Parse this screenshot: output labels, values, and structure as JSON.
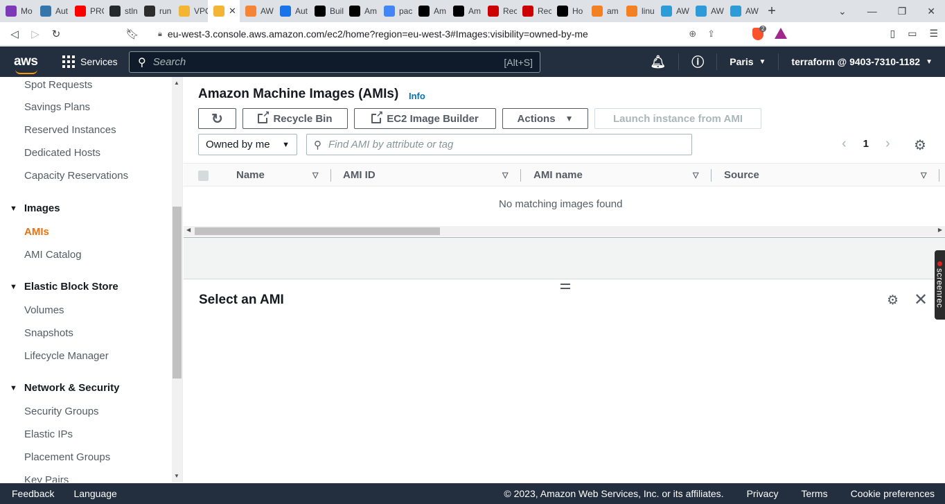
{
  "browser": {
    "tabs": [
      {
        "label": "Mo",
        "icon": "onion-icon",
        "color": "#7d3ab8"
      },
      {
        "label": "Aut",
        "icon": "python-icon",
        "color": "#3776ab"
      },
      {
        "label": "PRC",
        "icon": "youtube-icon",
        "color": "#ff0000"
      },
      {
        "label": "stln",
        "icon": "github-icon",
        "color": "#24292e"
      },
      {
        "label": "run",
        "icon": "terraform-icon",
        "color": "#2d2d2d"
      },
      {
        "label": "VPC",
        "icon": "aws-cube-icon",
        "color": "#f3b534"
      },
      {
        "label": "",
        "icon": "aws-cube-icon",
        "color": "#f3b534",
        "active": true
      },
      {
        "label": "AW",
        "icon": "aws-orange-icon",
        "color": "#f58536"
      },
      {
        "label": "Aut",
        "icon": "bookmark-blue-icon",
        "color": "#1a73e8"
      },
      {
        "label": "Buil",
        "icon": "hashicorp-icon",
        "color": "#000000"
      },
      {
        "label": "Am",
        "icon": "hashicorp-icon",
        "color": "#000000"
      },
      {
        "label": "pac",
        "icon": "google-icon",
        "color": "#4285f4"
      },
      {
        "label": "Am",
        "icon": "hashicorp-icon",
        "color": "#000000"
      },
      {
        "label": "Am",
        "icon": "hashicorp-icon",
        "color": "#000000"
      },
      {
        "label": "Rec",
        "icon": "redhat-icon",
        "color": "#cc0000"
      },
      {
        "label": "Rec",
        "icon": "redhat-icon",
        "color": "#cc0000"
      },
      {
        "label": "Ho",
        "icon": "medium-icon",
        "color": "#000000"
      },
      {
        "label": "am",
        "icon": "stackoverflow-icon",
        "color": "#f48024"
      },
      {
        "label": "linu",
        "icon": "stackoverflow-icon",
        "color": "#f48024"
      },
      {
        "label": "AW",
        "icon": "aws-cloud-icon",
        "color": "#2e9bd6"
      },
      {
        "label": "AW",
        "icon": "aws-cloud-icon",
        "color": "#2e9bd6"
      },
      {
        "label": "AW",
        "icon": "aws-cloud-icon",
        "color": "#2e9bd6"
      }
    ],
    "new_tab": "+",
    "url": "eu-west-3.console.aws.amazon.com/ec2/home?region=eu-west-3#Images:visibility=owned-by-me",
    "brave_badge": "2"
  },
  "header": {
    "logo": "aws",
    "services": "Services",
    "search_placeholder": "Search",
    "search_shortcut": "[Alt+S]",
    "region": "Paris",
    "account": "terraform @ 9403-7310-1182"
  },
  "sidebar": {
    "links_top": [
      "Spot Requests",
      "Savings Plans",
      "Reserved Instances",
      "Dedicated Hosts",
      "Capacity Reservations"
    ],
    "images_section": "Images",
    "images_links": [
      "AMIs",
      "AMI Catalog"
    ],
    "ebs_section": "Elastic Block Store",
    "ebs_links": [
      "Volumes",
      "Snapshots",
      "Lifecycle Manager"
    ],
    "network_section": "Network & Security",
    "network_links": [
      "Security Groups",
      "Elastic IPs",
      "Placement Groups",
      "Key Pairs"
    ]
  },
  "main": {
    "title": "Amazon Machine Images (AMIs)",
    "info": "Info",
    "buttons": {
      "recycle_bin": "Recycle Bin",
      "image_builder": "EC2 Image Builder",
      "actions": "Actions",
      "launch": "Launch instance from AMI"
    },
    "filter_select": "Owned by me",
    "search_placeholder": "Find AMI by attribute or tag",
    "page": "1",
    "columns": [
      "Name",
      "AMI ID",
      "AMI name",
      "Source"
    ],
    "empty_message": "No matching images found",
    "detail_title": "Select an AMI"
  },
  "overlay": {
    "screenrec": "screenrec"
  },
  "footer": {
    "feedback": "Feedback",
    "language": "Language",
    "copyright": "© 2023, Amazon Web Services, Inc. or its affiliates.",
    "privacy": "Privacy",
    "terms": "Terms",
    "cookies": "Cookie preferences"
  }
}
